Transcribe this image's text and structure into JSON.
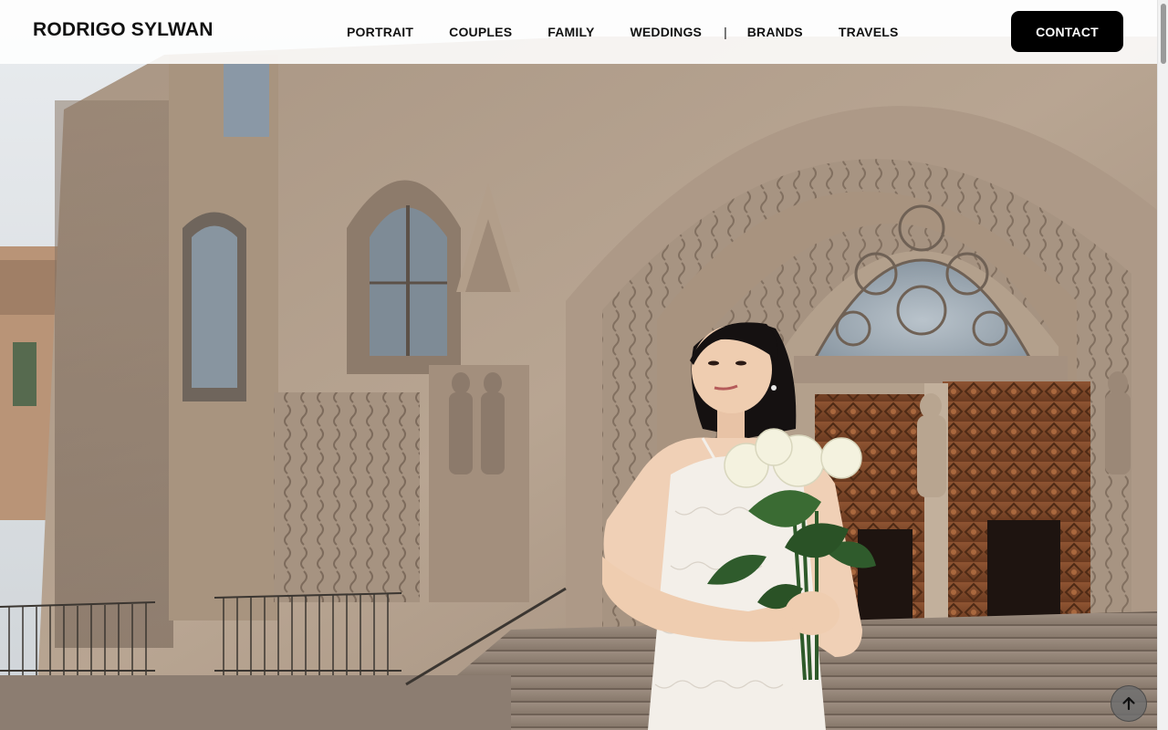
{
  "header": {
    "brand": "RODRIGO SYLWAN",
    "nav": [
      {
        "label": "PORTRAIT"
      },
      {
        "label": "COUPLES"
      },
      {
        "label": "FAMILY"
      },
      {
        "label": "WEDDINGS"
      },
      {
        "label": "BRANDS"
      },
      {
        "label": "TRAVELS"
      }
    ],
    "separator": "|",
    "contact_label": "CONTACT"
  },
  "hero": {
    "alt": "Bride holding white roses in front of a gothic cathedral"
  },
  "back_to_top": {
    "icon": "arrow-up-icon"
  },
  "colors": {
    "header_bg": "#ffffff",
    "contact_bg": "#000000",
    "contact_text": "#ffffff",
    "stone": "#b9a58f",
    "door": "#8a4f2c"
  }
}
